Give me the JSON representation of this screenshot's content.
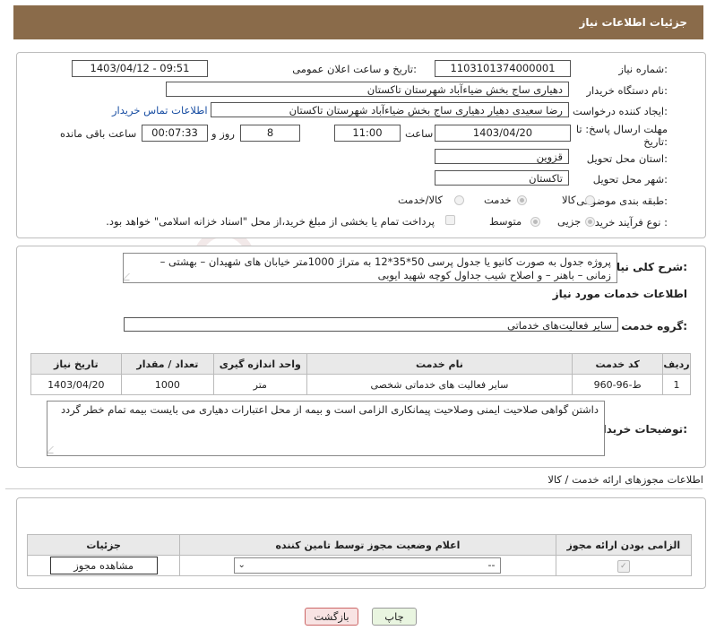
{
  "header": {
    "title": "جزئیات اطلاعات نیاز"
  },
  "need": {
    "number_label": "شماره نیاز:",
    "number": "1103101374000001",
    "announce_label": "تاریخ و ساعت اعلان عمومی:",
    "announce": "1403/04/12 - 09:51",
    "buyer_label": "نام دستگاه خریدار:",
    "buyer": "دهیاری ساج بخش ضیاءآباد شهرستان تاکستان",
    "creator_label": "ایجاد کننده درخواست:",
    "creator": "رضا سعیدی دهیار دهیاری ساج بخش ضیاءآباد شهرستان تاکستان",
    "contact_link": "اطلاعات تماس خریدار",
    "deadline_label_1": "مهلت ارسال پاسخ: تا",
    "deadline_label_2": "تاریخ:",
    "deadline_date": "1403/04/20",
    "time_label": "ساعت",
    "deadline_time": "11:00",
    "days": "8",
    "days_label": "روز و",
    "remaining": "00:07:33",
    "remaining_label": "ساعت باقی مانده",
    "province_label": "استان محل تحویل:",
    "province": "قزوین",
    "city_label": "شهر محل تحویل:",
    "city": "تاکستان",
    "category_label": "طبقه بندی موضوعی:",
    "category_options": [
      "کالا",
      "خدمت",
      "کالا/خدمت"
    ],
    "category_selected": "خدمت",
    "process_label": "نوع فرآیند خرید :",
    "process_options": [
      "جزیی",
      "متوسط"
    ],
    "process_selected": "جزیی",
    "payment_note": "پرداخت تمام یا بخشی از مبلغ خرید،از محل \"اسناد خزانه اسلامی\" خواهد بود."
  },
  "description": {
    "label": "شرح کلی نیاز:",
    "line1": "پروژه جدول به صورت کانیو  یا جدول پرسی  50*35*12  به متراژ 1000متر خیابان های شهیدان – بهشتی –",
    "line2": "زمانی – باهنر – و اصلاح شیب جداول کوچه شهید ایوبی"
  },
  "services": {
    "section_title": "اطلاعات خدمات مورد نیاز",
    "group_label": "گروه خدمت:",
    "group_value": "سایر فعالیت‌های خدماتی",
    "columns": [
      "ردیف",
      "کد خدمت",
      "نام خدمت",
      "واحد اندازه گیری",
      "تعداد / مقدار",
      "تاریخ نیاز"
    ],
    "rows": [
      [
        "1",
        "ط-96-960",
        "سایر فعالیت های خدماتی شخصی",
        "متر",
        "1000",
        "1403/04/20"
      ]
    ]
  },
  "buyer_notes": {
    "label": "توضیحات خریدار:",
    "text": "داشتن گواهی صلاحیت ایمنی وصلاحیت پیمانکاری الزامی است و بیمه از محل اعتبارات دهیاری می بایست بیمه تمام خطر گردد"
  },
  "permits": {
    "title": "اطلاعات مجوزهای ارائه خدمت / کالا",
    "columns": [
      "الزامی بودن ارائه مجوز",
      "اعلام وضعیت مجوز توسط تامین کننده",
      "جزئیات"
    ],
    "select_value": "--",
    "view_button": "مشاهده مجوز"
  },
  "actions": {
    "print": "چاپ",
    "back": "بازگشت"
  },
  "colors": {
    "header": "#8a6b4a",
    "link": "#1a4fa3",
    "print_btn": "#e9f5e0",
    "back_btn": "#f8e3e3"
  }
}
